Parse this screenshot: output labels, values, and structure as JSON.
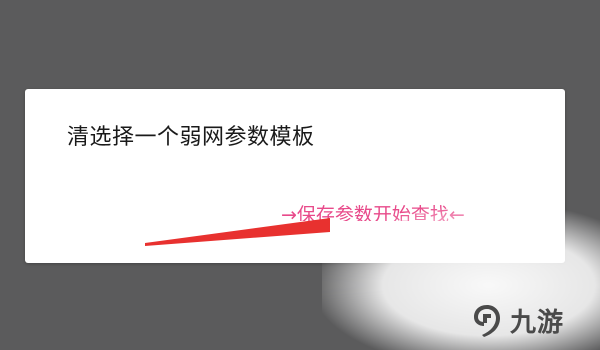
{
  "dialog": {
    "title": "清选择一个弱网参数模板"
  },
  "annotation": {
    "text": "→保存参数开始查找←",
    "color": "#e84a8a"
  },
  "pointer_arrow": {
    "color": "#e8312f"
  },
  "watermark": {
    "brand": "九游",
    "logo_icon": "nine-game-logo-icon"
  }
}
